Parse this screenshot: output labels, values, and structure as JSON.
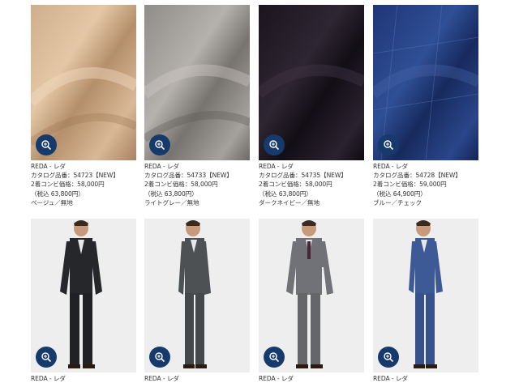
{
  "products": [
    {
      "brand": "REDA - レダ",
      "catalog": "カタログ品番：54723【NEW】",
      "price": "2着コンビ価格：58,000円",
      "tax": "（税込 63,800円）",
      "color": "ベージュ／無地",
      "fabric_color": "#c9a582",
      "icon": "zoom-icon"
    },
    {
      "brand": "REDA - レダ",
      "catalog": "カタログ品番：54733【NEW】",
      "price": "2着コンビ価格：58,000円",
      "tax": "（税込 63,800円）",
      "color": "ライトグレー／無地",
      "fabric_color": "#8d8b89",
      "icon": "zoom-icon"
    },
    {
      "brand": "REDA - レダ",
      "catalog": "カタログ品番：54735【NEW】",
      "price": "2着コンビ価格：58,000円",
      "tax": "（税込 63,800円）",
      "color": "ダークネイビー／無地",
      "fabric_color": "#1a1420",
      "icon": "zoom-icon"
    },
    {
      "brand": "REDA - レダ",
      "catalog": "カタログ品番：54728【NEW】",
      "price": "2着コンビ価格：59,000円",
      "tax": "（税込 64,900円）",
      "color": "ブルー／チェック",
      "fabric_color": "#203a78",
      "icon": "zoom-icon"
    }
  ],
  "models": [
    {
      "brand": "REDA - レダ",
      "suit_color": "#25272b",
      "icon": "zoom-icon"
    },
    {
      "brand": "REDA - レダ",
      "suit_color": "#4e5154",
      "icon": "zoom-icon"
    },
    {
      "brand": "REDA - レダ",
      "suit_color": "#707277",
      "icon": "zoom-icon"
    },
    {
      "brand": "REDA - レダ",
      "suit_color": "#3d5a96",
      "icon": "zoom-icon"
    }
  ],
  "accent_color": "#163a6b"
}
